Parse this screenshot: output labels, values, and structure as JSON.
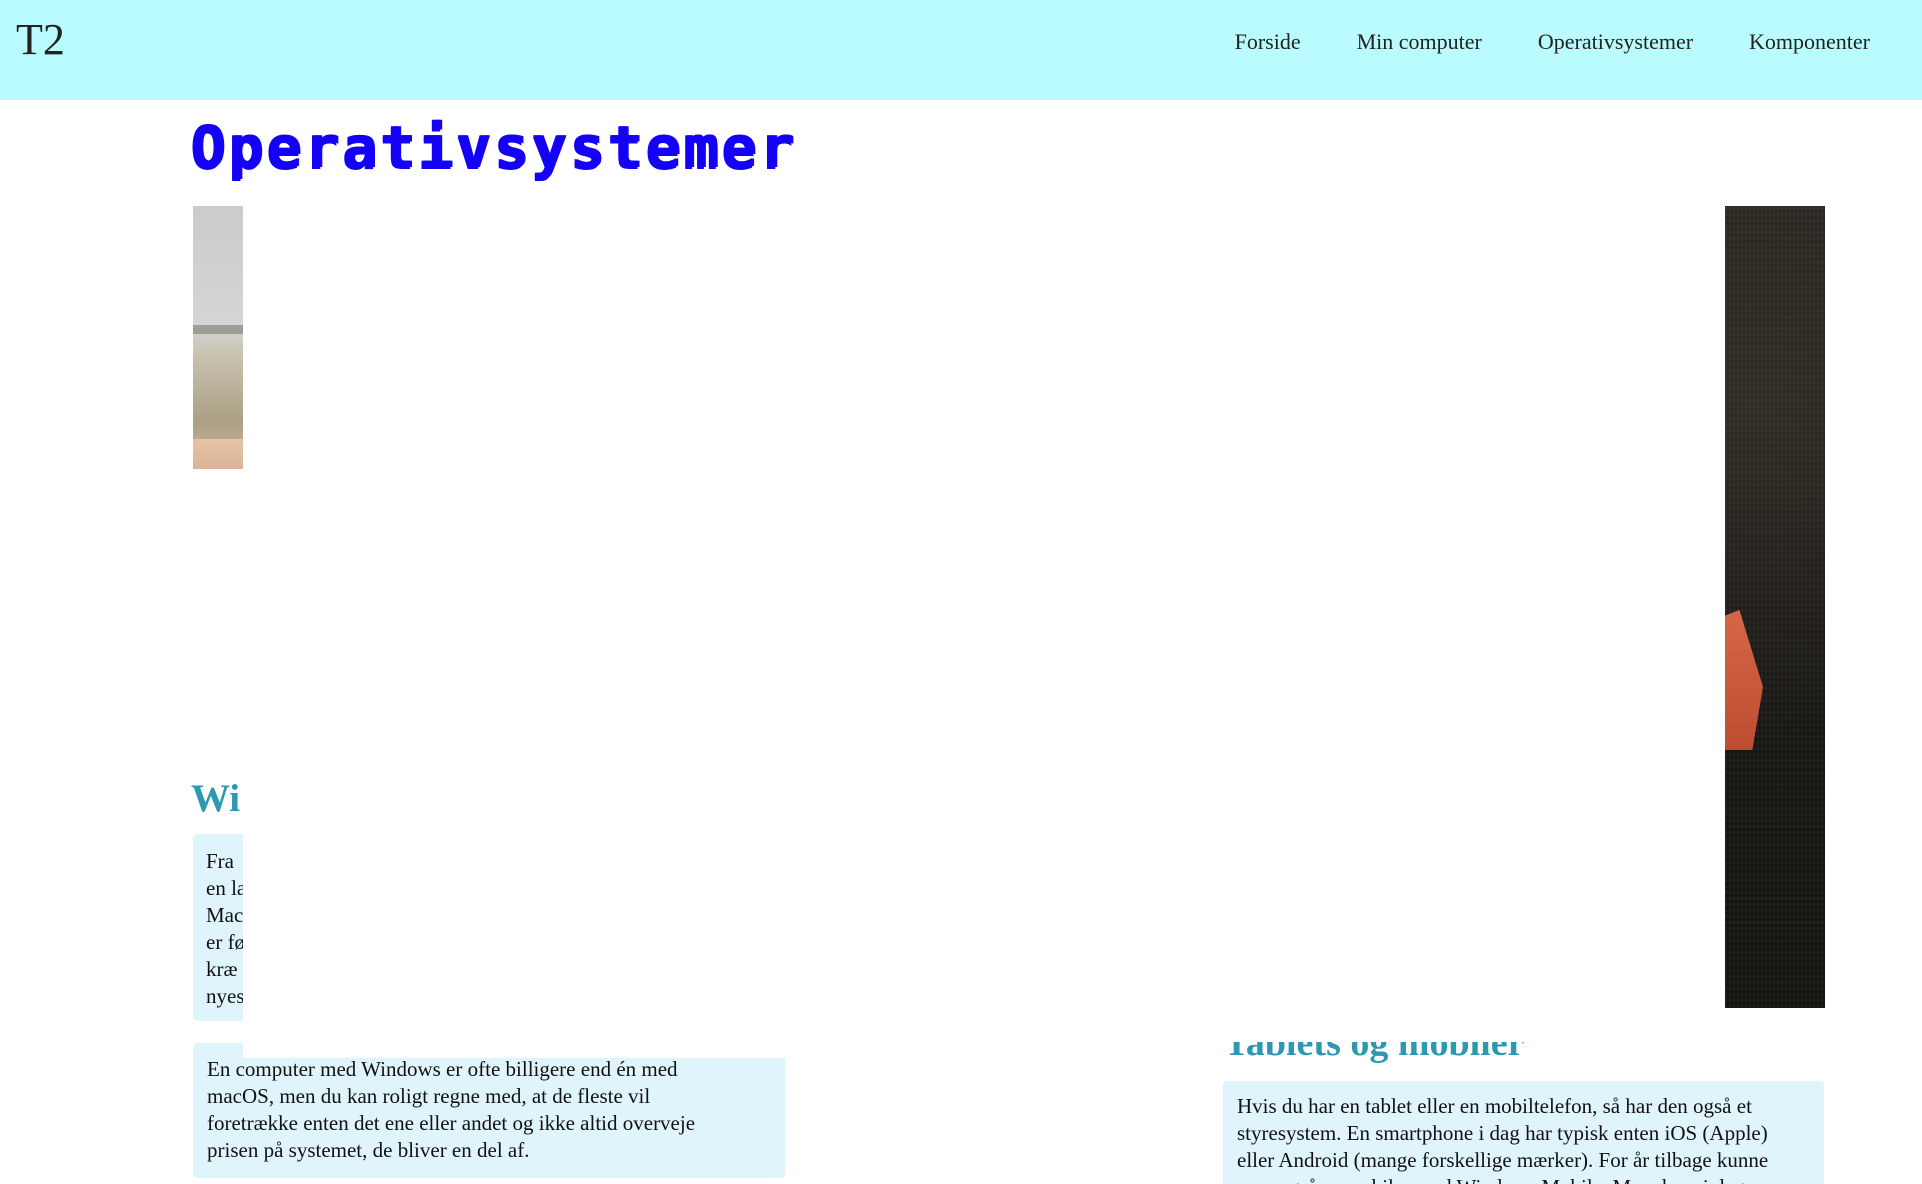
{
  "header": {
    "brand": "T2",
    "nav": [
      {
        "label": "Forside"
      },
      {
        "label": "Min computer"
      },
      {
        "label": "Operativsystemer"
      },
      {
        "label": "Komponenter"
      }
    ]
  },
  "main": {
    "title": "Operativsystemer",
    "left_section": {
      "heading_fragment": "Wi",
      "cropped_paragraph_fragment": "Fra\nen la\nMac\ner fø\nkræ\nnyes"
    },
    "left_bottom_card": {
      "text": "En computer med Windows er ofte billigere end én med\nmacOS, men du kan roligt regne med, at de fleste vil\nforetrække enten det ene eller andet og ikke altid overveje\nprisen på systemet, de bliver en del af."
    },
    "right_section": {
      "heading": "Tablets og mobiler",
      "text": "Hvis du har en tablet eller en mobiltelefon, så har den også et\nstyresystem. En smartphone i dag har typisk enten iOS (Apple)\neller Android (mange forskellige mærker). For år tilbage kunne\nman også se mobiler med Windows Mobile. Men de er i dag en"
    }
  },
  "colors": {
    "header_bg": "#b9fbff",
    "title": "#1400f5",
    "section_heading": "#2d99b0",
    "card_bg": "#dff4fb"
  }
}
